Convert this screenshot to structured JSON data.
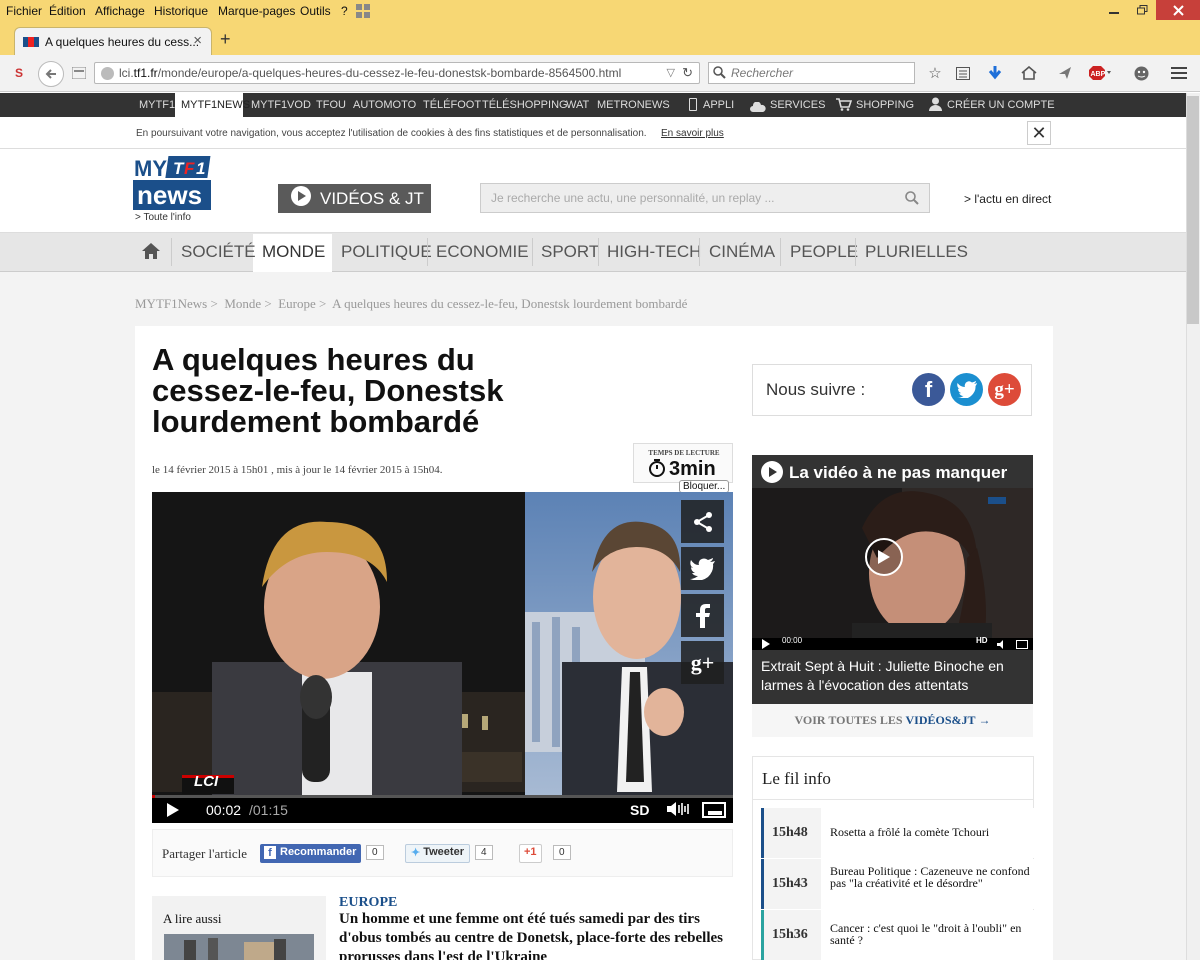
{
  "menubar": {
    "items": [
      "Fichier",
      "Édition",
      "Affichage",
      "Historique",
      "Marque-pages",
      "Outils",
      "?"
    ]
  },
  "tab": {
    "title": "A quelques heures du cess...",
    "close": "×",
    "new": "+"
  },
  "url": {
    "prefix": "lci.",
    "domain": "tf1.fr",
    "path": "/monde/europe/a-quelques-heures-du-cessez-le-feu-donestsk-bombarde-8564500.html"
  },
  "search": {
    "placeholder": "Rechercher"
  },
  "sitebar": {
    "items": [
      "MYTF1",
      "MYTF1NEWS",
      "MYTF1VOD",
      "TFOU",
      "AUTOMOTO",
      "TÉLÉFOOT",
      "TÉLÉSHOPPING",
      "WAT",
      "METRONEWS",
      "APPLI",
      "SERVICES",
      "SHOPPING",
      "CRÉER UN COMPTE"
    ]
  },
  "cookie": {
    "text": "En poursuivant votre navigation, vous acceptez l'utilisation de cookies à des fins statistiques et de personnalisation.",
    "link": "En savoir plus",
    "close": "✕"
  },
  "logo": {
    "tagline": "> Toute l'info"
  },
  "videos_btn": "VIDÉOS & JT",
  "site_search": {
    "placeholder": "Je recherche une actu, une personnalité, un replay ..."
  },
  "direct": "> l'actu en direct",
  "sections": [
    "SOCIÉTÉ",
    "MONDE",
    "POLITIQUE",
    "ECONOMIE",
    "SPORT",
    "HIGH-TECH",
    "CINÉMA",
    "PEOPLE",
    "PLURIELLES"
  ],
  "breadcrumb": [
    "MYTF1News >",
    "Monde >",
    "Europe >",
    "A quelques heures du cessez-le-feu, Donestsk lourdement bombardé"
  ],
  "article": {
    "title": "A quelques heures du cessez-le-feu, Donestsk lourdement bombardé",
    "date": "le 14 février 2015 à 15h01 , mis à jour le 14 février 2015 à 15h04.",
    "readtime_label": "TEMPS DE LECTURE",
    "readtime": "3min",
    "bloquer": "Bloquer...",
    "video": {
      "current": "00:02",
      "total": "/01:15",
      "quality": "SD",
      "logo": "LCI"
    },
    "share": {
      "label": "Partager l'article",
      "fb": "Recommander",
      "fb_count": "0",
      "tw": "Tweeter",
      "tw_count": "4",
      "gp": "+1",
      "gp_count": "0"
    },
    "alire": "A lire aussi",
    "category": "EUROPE",
    "lead": "Un homme et une femme ont été tués samedi par des tirs d'obus tombés au centre de Donetsk, place-forte des rebelles prorusses dans l'est de l'Ukraine"
  },
  "sidebar": {
    "follow": "Nous suivre :",
    "video_head": "La vidéo à ne pas manquer",
    "video_time": "00:00",
    "video_caption": "Extrait Sept à Huit : Juliette Binoche en larmes à l'évocation des attentats",
    "voir_prefix": "VOIR TOUTES LES ",
    "voir_link": "VIDÉOS&JT",
    "fil_title": "Le fil info",
    "fil": [
      {
        "time": "15h48",
        "text": "Rosetta a frôlé la comète Tchouri"
      },
      {
        "time": "15h43",
        "text": "Bureau Politique : Cazeneuve ne confond pas \"la créativité et le désordre\""
      },
      {
        "time": "15h36",
        "text": "Cancer : c'est quoi le \"droit à l'oubli\" en santé ?"
      }
    ]
  },
  "colors": {
    "menubar": "#f7d774",
    "accent": "#1b4f8a",
    "facebook": "#3b5998",
    "twitter": "#55acee",
    "gplus": "#dd4b39"
  }
}
